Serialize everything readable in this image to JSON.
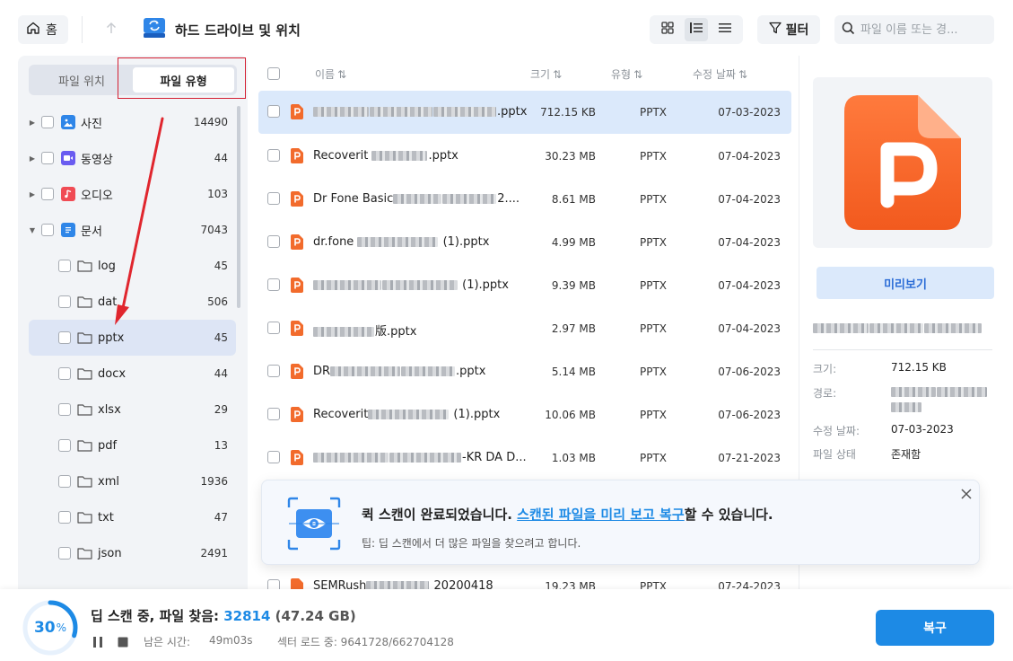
{
  "topbar": {
    "home_label": "홈",
    "location_title": "하드 드라이브 및 위치",
    "filter_label": "필터",
    "search_placeholder": "파일 이름 또는 경..."
  },
  "sidebar": {
    "tabs": {
      "location": "파일 위치",
      "type": "파일 유형"
    },
    "categories": [
      {
        "label": "사진",
        "count": "14490",
        "icon": "image-icon",
        "color": "#2f86e8"
      },
      {
        "label": "동영상",
        "count": "44",
        "icon": "video-icon",
        "color": "#6a5cf0"
      },
      {
        "label": "오디오",
        "count": "103",
        "icon": "audio-icon",
        "color": "#f04b54"
      },
      {
        "label": "문서",
        "count": "7043",
        "icon": "document-icon",
        "color": "#2f86e8"
      }
    ],
    "folders": [
      {
        "label": "log",
        "count": "45"
      },
      {
        "label": "dat",
        "count": "506"
      },
      {
        "label": "pptx",
        "count": "45"
      },
      {
        "label": "docx",
        "count": "44"
      },
      {
        "label": "xlsx",
        "count": "29"
      },
      {
        "label": "pdf",
        "count": "13"
      },
      {
        "label": "xml",
        "count": "1936"
      },
      {
        "label": "txt",
        "count": "47"
      },
      {
        "label": "json",
        "count": "2491"
      }
    ]
  },
  "list": {
    "headers": {
      "name": "이름",
      "size": "크기",
      "type": "유형",
      "date": "수정 날짜"
    },
    "rows": [
      {
        "name_visible": ".pptx",
        "size": "712.15 KB",
        "type": "PPTX",
        "date": "07-03-2023"
      },
      {
        "name_visible": "Recoverit",
        "name_suffix": ".pptx",
        "size": "30.23 MB",
        "type": "PPTX",
        "date": "07-04-2023"
      },
      {
        "name_visible": "Dr Fone Basic",
        "name_suffix": "2....",
        "size": "8.61 MB",
        "type": "PPTX",
        "date": "07-04-2023"
      },
      {
        "name_visible": "dr.fone",
        "name_suffix": " (1).pptx",
        "size": "4.99 MB",
        "type": "PPTX",
        "date": "07-04-2023"
      },
      {
        "name_visible": "",
        "name_suffix": " (1).pptx",
        "size": "9.39 MB",
        "type": "PPTX",
        "date": "07-04-2023"
      },
      {
        "name_visible": "",
        "name_suffix": "版.pptx",
        "size": "2.97 MB",
        "type": "PPTX",
        "date": "07-04-2023"
      },
      {
        "name_visible": "DR",
        "name_suffix": ".pptx",
        "size": "5.14 MB",
        "type": "PPTX",
        "date": "07-06-2023"
      },
      {
        "name_visible": "Recoverit",
        "name_suffix": "  (1).pptx",
        "size": "10.06 MB",
        "type": "PPTX",
        "date": "07-06-2023"
      },
      {
        "name_visible": "",
        "name_suffix": "-KR DA D...",
        "size": "1.03 MB",
        "type": "PPTX",
        "date": "07-21-2023"
      }
    ],
    "partial_row": {
      "name_visible": "SEMRush",
      "name_suffix": " 20200418",
      "size": "19.23 MB",
      "type": "PPTX",
      "date": "07-24-2023"
    }
  },
  "preview": {
    "button_label": "미리보기",
    "size_label": "크기:",
    "size_value": "712.15 KB",
    "path_label": "경로:",
    "date_label": "수정 날짜:",
    "date_value": "07-03-2023",
    "status_label": "파일 상태",
    "status_value": "존재함"
  },
  "toast": {
    "title_before": "퀵 스캔이 완료되었습니다. ",
    "title_link": "스캔된 파일을 미리 보고 복구",
    "title_after": "할 수 있습니다.",
    "tip": "팁: 딥 스캔에서 더 많은 파일을 찾으려고 합니다."
  },
  "bottom": {
    "progress_percent": "30",
    "percent_sign": "%",
    "scan_label": "딥 스캔 중, 파일 찾음: ",
    "found_count": "32814",
    "found_size": " (47.24 GB)",
    "time_label": "남은 시간:",
    "time_value": "49m03s",
    "sector_text": "섹터 로드 중: 9641728/662704128",
    "recover_label": "복구"
  },
  "colors": {
    "accent": "#1d8ae5",
    "pptx": "#f26b2c",
    "highlight_red": "#d42033"
  }
}
